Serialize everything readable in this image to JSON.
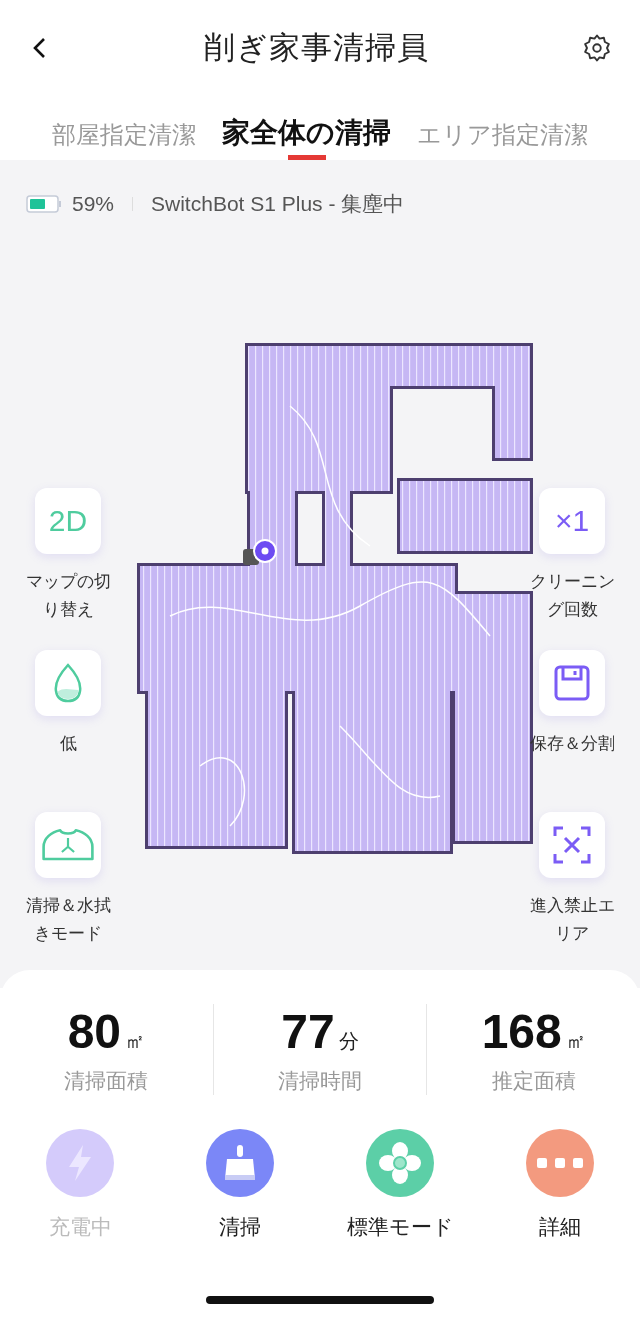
{
  "header": {
    "title": "削ぎ家事清掃員"
  },
  "tabs": [
    {
      "label": "部屋指定清潔",
      "selected": false
    },
    {
      "label": "家全体の清掃",
      "selected": true
    },
    {
      "label": "エリア指定清潔",
      "selected": false
    }
  ],
  "status": {
    "battery": "59%",
    "device": "SwitchBot S1 Plus - 集塵中"
  },
  "left_controls": [
    {
      "kind": "map",
      "icon_text": "2D",
      "label": "マップの切り替え"
    },
    {
      "kind": "drop",
      "label": "低"
    },
    {
      "kind": "mop",
      "label": "清掃＆水拭きモード"
    }
  ],
  "right_controls": [
    {
      "kind": "count",
      "icon_text": "×1",
      "label": "クリーニング回数"
    },
    {
      "kind": "save",
      "label": "保存＆分割"
    },
    {
      "kind": "nogo",
      "label": "進入禁止エリア"
    }
  ],
  "stats": [
    {
      "value": "80",
      "unit": "㎡",
      "label": "清掃面積"
    },
    {
      "value": "77",
      "unit": "分",
      "label": "清掃時間"
    },
    {
      "value": "168",
      "unit": "㎡",
      "label": "推定面積"
    }
  ],
  "actions": [
    {
      "kind": "charge",
      "label": "充電中",
      "color": "#d4cbfb",
      "disabled": true
    },
    {
      "kind": "clean",
      "label": "清掃",
      "color": "#7b87f7",
      "disabled": false
    },
    {
      "kind": "fan",
      "label": "標準モード",
      "color": "#5ccfa7",
      "disabled": false
    },
    {
      "kind": "more",
      "label": "詳細",
      "color": "#f39a7f",
      "disabled": false
    }
  ]
}
